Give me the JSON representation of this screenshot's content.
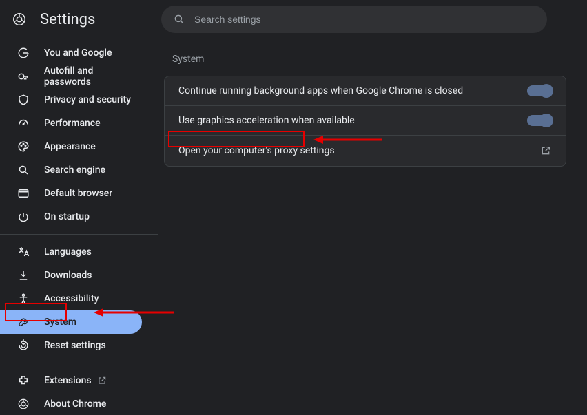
{
  "header": {
    "title": "Settings",
    "search_placeholder": "Search settings"
  },
  "sidebar": {
    "groups": [
      [
        {
          "icon": "google",
          "label": "You and Google"
        },
        {
          "icon": "autofill",
          "label": "Autofill and passwords"
        },
        {
          "icon": "shield",
          "label": "Privacy and security"
        },
        {
          "icon": "speed",
          "label": "Performance"
        },
        {
          "icon": "palette",
          "label": "Appearance"
        },
        {
          "icon": "search",
          "label": "Search engine"
        },
        {
          "icon": "browser",
          "label": "Default browser"
        },
        {
          "icon": "power",
          "label": "On startup"
        }
      ],
      [
        {
          "icon": "translate",
          "label": "Languages"
        },
        {
          "icon": "download",
          "label": "Downloads"
        },
        {
          "icon": "accessibility",
          "label": "Accessibility"
        },
        {
          "icon": "wrench",
          "label": "System",
          "active": true
        },
        {
          "icon": "reset",
          "label": "Reset settings"
        }
      ],
      [
        {
          "icon": "extension",
          "label": "Extensions",
          "external": true
        },
        {
          "icon": "chrome",
          "label": "About Chrome"
        }
      ]
    ]
  },
  "main": {
    "section_title": "System",
    "rows": [
      {
        "label": "Continue running background apps when Google Chrome is closed",
        "type": "toggle",
        "value": true
      },
      {
        "label": "Use graphics acceleration when available",
        "type": "toggle",
        "value": true
      },
      {
        "label": "Open your computer's proxy settings",
        "type": "link"
      }
    ]
  },
  "annotations": {
    "highlight_color": "#e60000",
    "arrows": [
      "pointing to System sidebar item",
      "pointing to proxy settings row"
    ]
  }
}
